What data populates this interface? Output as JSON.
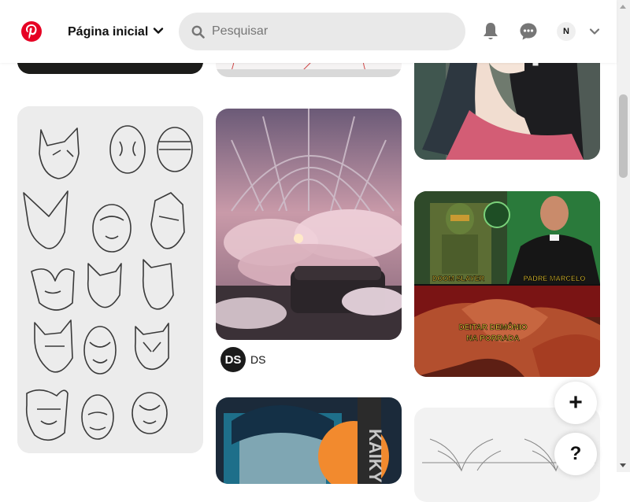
{
  "header": {
    "home_label": "Página inicial",
    "search_placeholder": "Pesquisar",
    "avatar_initial": "N"
  },
  "pins": {
    "creator_ds": {
      "initials": "DS",
      "name": "DS"
    },
    "meme": {
      "top_left_caption": "DOOM SLAYER",
      "top_right_caption": "PADRE MARCELO",
      "bottom_caption_line1": "DEITAR DEMÔNIO",
      "bottom_caption_line2": "NA PORRADA"
    }
  },
  "fab": {
    "add_label": "+",
    "help_label": "?"
  },
  "colors": {
    "brand": "#E60023",
    "search_bg": "#e9e9e9"
  },
  "icons": [
    "pinterest-logo-icon",
    "chevron-down-icon",
    "search-icon",
    "bell-icon",
    "chat-icon",
    "account-chevron-icon"
  ]
}
